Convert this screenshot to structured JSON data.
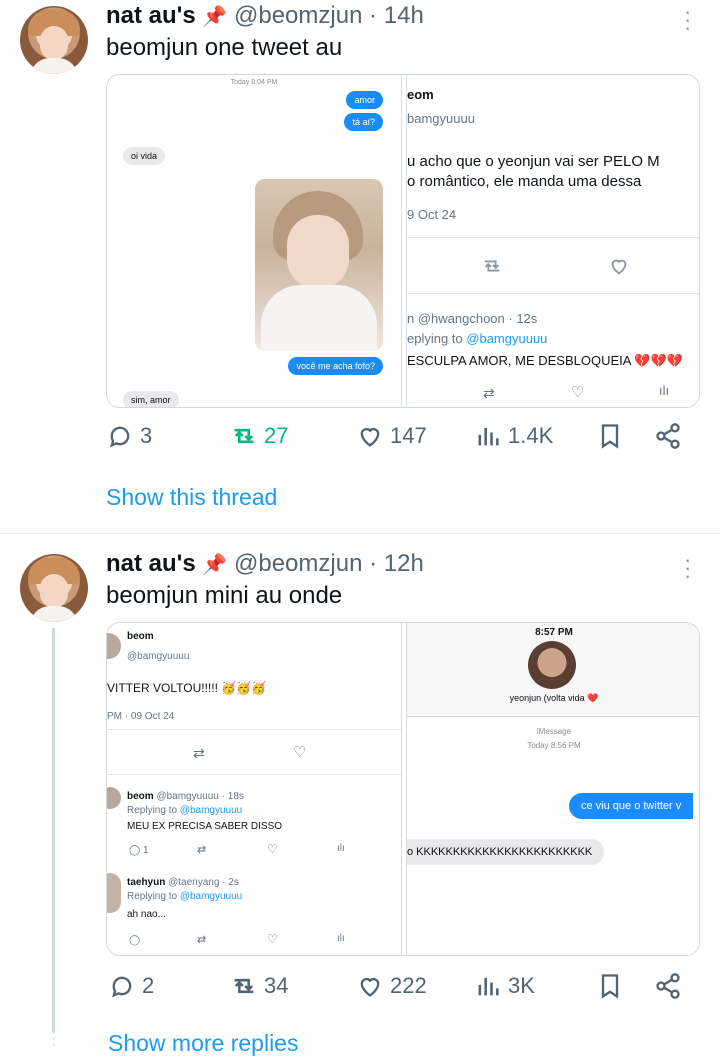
{
  "tweets": [
    {
      "name": "nat au's",
      "pin": "📌",
      "handle": "@beomzjun",
      "time": "· 14h",
      "text": "beomjun one tweet au",
      "media": {
        "left": {
          "timestamp": "Today 8:04 PM",
          "msg1": "amor",
          "msg2": "tá aí?",
          "reply1": "oi vida",
          "msg3": "você me acha fofo?",
          "reply2": "sim, amor"
        },
        "right": {
          "name": "eom",
          "handle": "bamgyuuuu",
          "text1": "u acho que o yeonjun vai ser PELO M",
          "text2": "o romântico, ele manda uma dessa",
          "date": "9 Oct 24",
          "reply_user": "n @hwangchoon · 12s",
          "reply_to_label": "eplying to ",
          "reply_to_handle": "@bamgyuuuu",
          "reply_text": "ESCULPA AMOR, ME DESBLOQUEIA 💔💔💔"
        }
      },
      "stats": {
        "replies": "3",
        "retweets": "27",
        "likes": "147",
        "views": "1.4K"
      },
      "show_label": "Show this thread"
    },
    {
      "name": "nat au's",
      "pin": "📌",
      "handle": "@beomzjun",
      "time": "· 12h",
      "text": "beomjun mini au onde",
      "media": {
        "left": {
          "name": "beom",
          "handle": "@bamgyuuuu",
          "text": "VITTER VOLTOU!!!!! 🥳🥳🥳",
          "date": "PM · 09 Oct 24",
          "r1_user": "beom",
          "r1_meta": "@bamgyuuuu · 18s",
          "r1_replying": "Replying to ",
          "r1_to": "@bamgyuuuu",
          "r1_text": "MEU EX PRECISA SABER DISSO",
          "r1_count": "1",
          "r2_user": "taehyun",
          "r2_meta": "@taenyang · 2s",
          "r2_replying": "Replying to ",
          "r2_to": "@bamgyuuuu",
          "r2_text": "ah nao..."
        },
        "right": {
          "clock": "8:57 PM",
          "contact": "yeonjun (volta vida ❤️",
          "service": "iMessage",
          "time": "Today 8:56 PM",
          "msg": "ce viu que o twitter v",
          "reply": "o KKKKKKKKKKKKKKKKKKKKKKKK"
        }
      },
      "stats": {
        "replies": "2",
        "retweets": "34",
        "likes": "222",
        "views": "3K"
      },
      "show_label": "Show more replies"
    }
  ]
}
